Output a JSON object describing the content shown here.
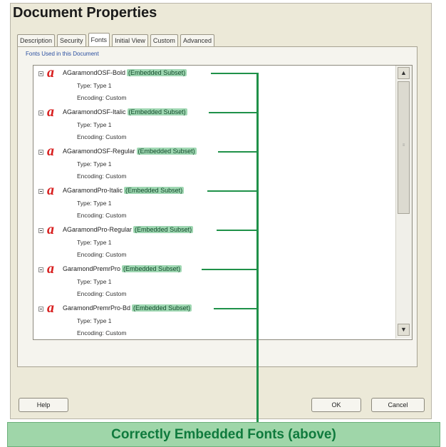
{
  "window": {
    "title": "Document Properties"
  },
  "tabs": [
    {
      "label": "Description"
    },
    {
      "label": "Security"
    },
    {
      "label": "Fonts",
      "active": true
    },
    {
      "label": "Initial View"
    },
    {
      "label": "Custom"
    },
    {
      "label": "Advanced"
    }
  ],
  "group": {
    "label": "Fonts Used in this Document"
  },
  "fonts": [
    {
      "name": "AGaramondOSF-Bold",
      "status": "(Embedded Subset)",
      "type": "Type: Type 1",
      "encoding": "Encoding: Custom"
    },
    {
      "name": "AGaramondOSF-Italic",
      "status": "(Embedded Subset)",
      "type": "Type: Type 1",
      "encoding": "Encoding: Custom"
    },
    {
      "name": "AGaramondOSF-Regular",
      "status": "(Embedded Subset)",
      "type": "Type: Type 1",
      "encoding": "Encoding: Custom"
    },
    {
      "name": "AGaramondPro-Italic",
      "status": "(Embedded Subset)",
      "type": "Type: Type 1",
      "encoding": "Encoding: Custom"
    },
    {
      "name": "AGaramondPro-Regular",
      "status": "(Embedded Subset)",
      "type": "Type: Type 1",
      "encoding": "Encoding: Custom"
    },
    {
      "name": "GaramondPremrPro",
      "status": "(Embedded Subset)",
      "type": "Type: Type 1",
      "encoding": "Encoding: Custom"
    },
    {
      "name": "GaramondPremrPro-Bd",
      "status": "(Embedded Subset)",
      "type": "Type: Type 1",
      "encoding": "Encoding: Custom"
    }
  ],
  "buttons": {
    "help": "Help",
    "ok": "OK",
    "cancel": "Cancel"
  },
  "scroll": {
    "up": "▲",
    "down": "▼"
  },
  "callout": {
    "text": "Correctly Embedded Fonts (above)"
  },
  "colors": {
    "highlight": "#9fd7b2",
    "connector": "#1f9149",
    "callout_bg": "#9fd6a9",
    "callout_text": "#0f7a3d"
  }
}
